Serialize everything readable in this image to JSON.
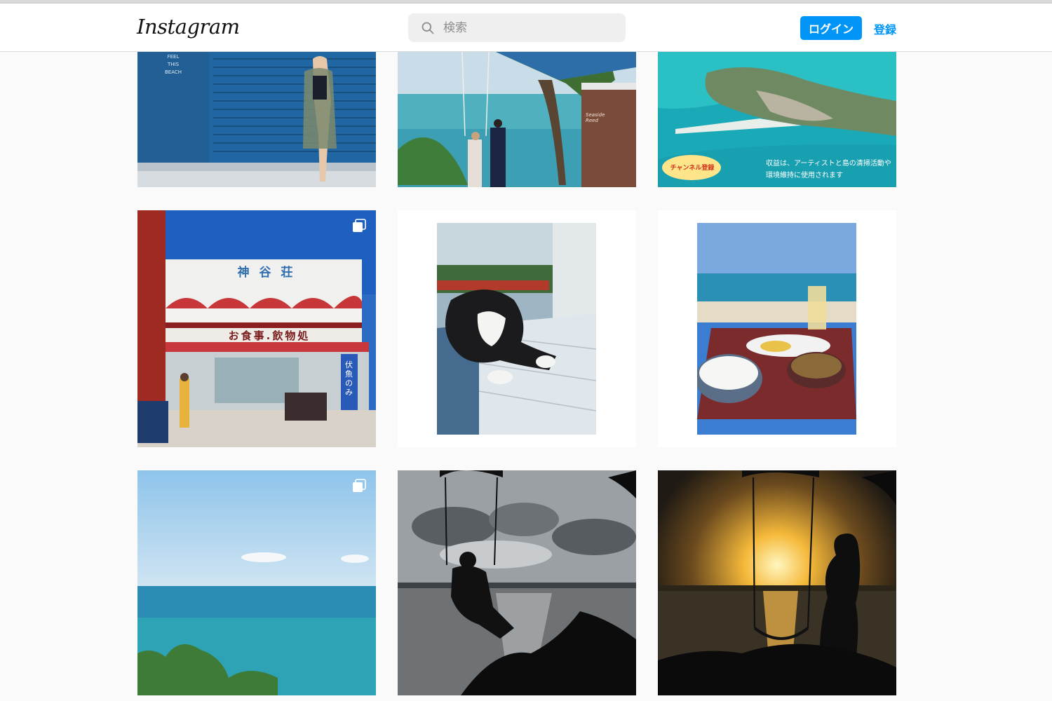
{
  "header": {
    "logo": "Instagram",
    "search_placeholder": "検索",
    "login_label": "ログイン",
    "signup_label": "登録"
  },
  "posts": [
    {
      "sign": "FEEL THIS BEACH"
    },
    {
      "sign": "Seaside Reed"
    },
    {
      "badge": "チャンネル登録",
      "caption": "収益は、アーティストと島の清掃活動や環境維持に使用されます"
    },
    {
      "building_name": "神 谷 荘",
      "shop_sign": "お食事.飲物処",
      "banner": "伏魚のみ",
      "multi": true
    },
    {},
    {},
    {
      "multi": true
    },
    {},
    {}
  ],
  "colors": {
    "accent": "#0095f6"
  }
}
